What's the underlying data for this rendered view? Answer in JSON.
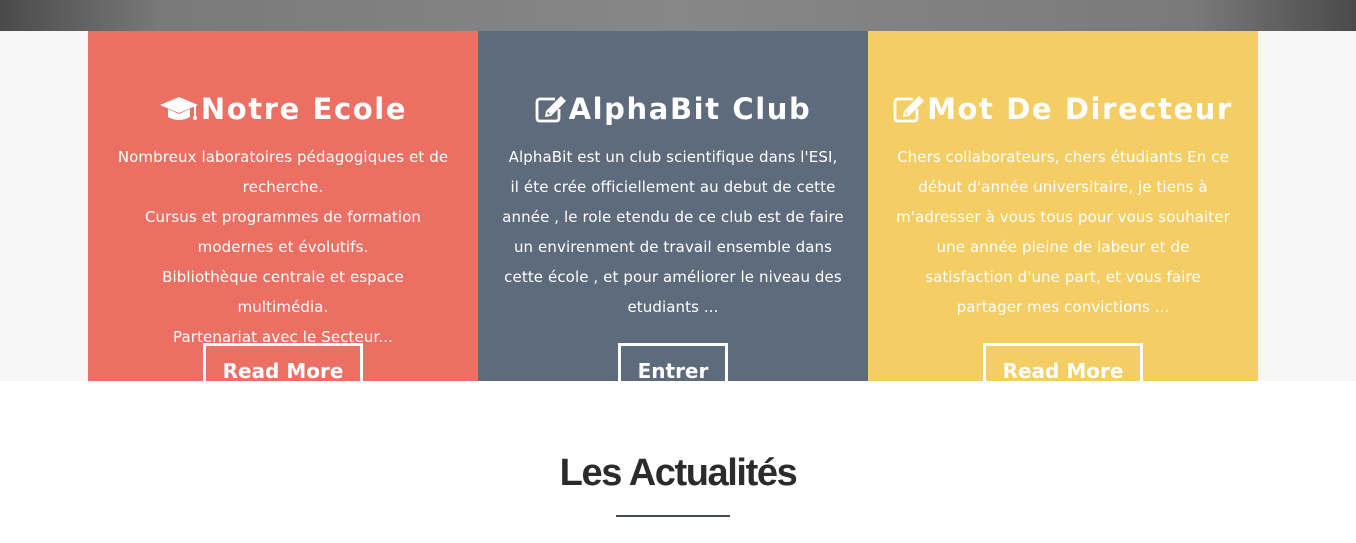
{
  "colors": {
    "card_red": "#ec6f63",
    "card_slate": "#5d6b7c",
    "card_yellow": "#f4cd65",
    "top_bar": "#878787",
    "band": "#f6f6f6",
    "section_title": "#2b2b2b"
  },
  "cards": [
    {
      "icon": "graduation-cap-icon",
      "title": "Notre Ecole",
      "lines": [
        "Nombreux laboratoires pédagogiques et de",
        "recherche.",
        "Cursus et programmes de formation",
        "modernes et évolutifs.",
        "Bibliothèque centrale et espace",
        "multimédia.",
        "Partenariat avec le Secteur..."
      ],
      "button": "Read More"
    },
    {
      "icon": "edit-icon",
      "title": "AlphaBit Club",
      "lines": [
        "AlphaBit est un club scientifique dans l'ESI,",
        "il éte crée officiellement au debut de cette",
        "année , le role etendu de ce club est de faire",
        "un envirenment de travail ensemble dans",
        "cette école , et pour améliorer le niveau des",
        "etudiants ..."
      ],
      "button": "Entrer"
    },
    {
      "icon": "edit-icon",
      "title": "Mot De Directeur",
      "lines": [
        "Chers collaborateurs, chers étudiants En ce",
        "début d'année universitaire, je tiens à",
        "m'adresser à vous tous pour vous souhaiter",
        "une année pleine de labeur et de",
        "satisfaction d'une part, et vous faire",
        "partager mes convictions ..."
      ],
      "button": "Read More"
    }
  ],
  "news": {
    "title": "Les Actualités"
  }
}
